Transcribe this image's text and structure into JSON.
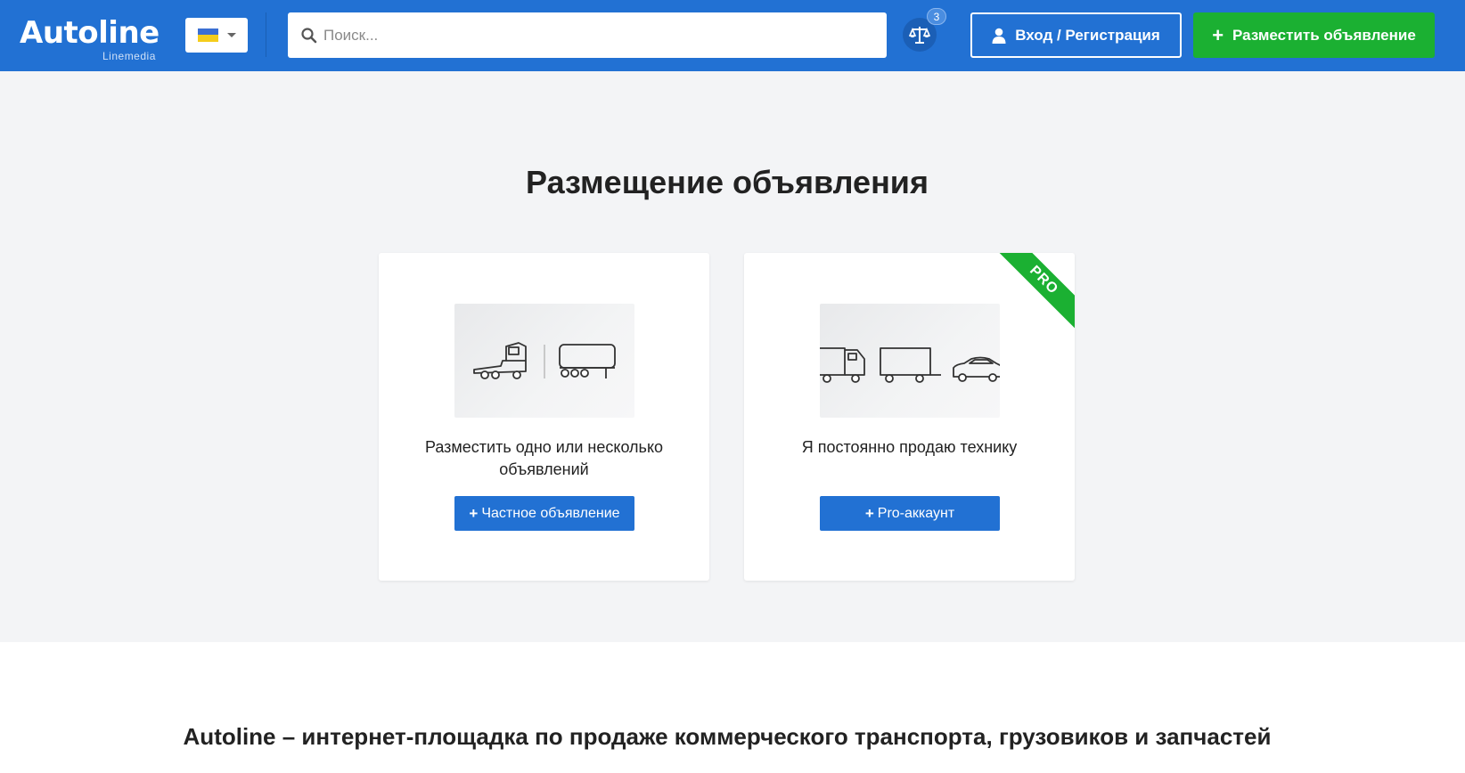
{
  "header": {
    "logo_text": "Autoline",
    "logo_sub": "Linemedia",
    "language_flag": "ukraine-flag-icon",
    "search": {
      "placeholder": "Поиск..."
    },
    "compare_count": "3",
    "login_label": "Вход / Регистрация",
    "post_label": "Разместить объявление"
  },
  "main": {
    "title": "Размещение объявления",
    "cards": [
      {
        "text": "Разместить одно или несколько объявлений",
        "button_label": "Частное объявление",
        "image_icon": "truck-tractor-and-trailer-icon"
      },
      {
        "badge": "PRO",
        "text": "Я постоянно продаю технику",
        "button_label": "Pro-аккаунт",
        "image_icon": "truck-trailer-car-icon"
      }
    ]
  },
  "about": {
    "title": "Autoline – интернет-площадка по продаже коммерческого транспорта, грузовиков и запчастей"
  },
  "colors": {
    "header_blue": "#2271d3",
    "accent_green": "#1bb032",
    "hero_background": "#f3f4f6"
  }
}
